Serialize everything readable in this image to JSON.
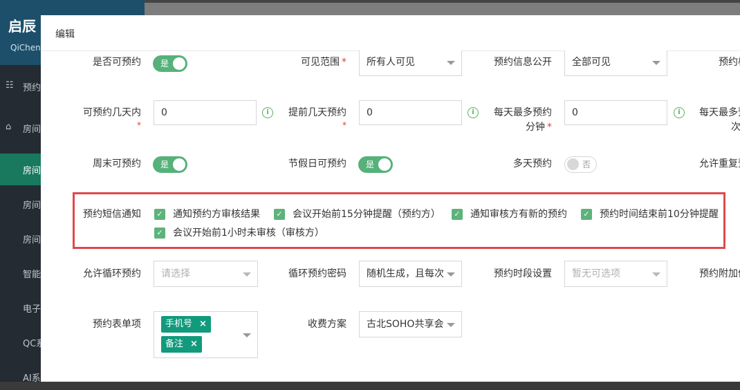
{
  "app": {
    "brand_title": "启辰",
    "brand_sub": "QiChen"
  },
  "sidebar": [
    {
      "icon": "☷",
      "label": "预约"
    },
    {
      "icon": "⌂",
      "label": "房间"
    },
    {
      "icon": "",
      "label": "房间"
    },
    {
      "icon": "",
      "label": "房间"
    },
    {
      "icon": "",
      "label": "房间"
    },
    {
      "icon": "",
      "label": "智能"
    },
    {
      "icon": "",
      "label": "电子"
    },
    {
      "icon": "",
      "label": "QC系"
    },
    {
      "icon": "",
      "label": "AI系"
    }
  ],
  "modal": {
    "title": "编辑"
  },
  "form": {
    "row1": {
      "bookable_label": "是否可预约",
      "bookable_toggle": "是",
      "visible_label": "可见范围",
      "visible_value": "所有人可见",
      "info_public_label": "预约信息公开",
      "info_public_value": "全部可见",
      "cut_label": "预约栏"
    },
    "row2": {
      "days_label_a": "可预约几天内",
      "days_value": "0",
      "advance_label": "提前几天预约",
      "advance_value": "0",
      "max_minutes_label_a": "每天最多预约",
      "max_minutes_label_b": "分钟",
      "max_minutes_value": "0",
      "max_times_label_a": "每天最多预",
      "max_times_label_b": "次"
    },
    "row3": {
      "weekend_label": "周末可预约",
      "weekend_toggle": "是",
      "holiday_label": "节假日可预约",
      "holiday_toggle": "是",
      "multiday_label": "多天预约",
      "multiday_toggle": "否",
      "repeat_label": "允许重复预"
    },
    "sms": {
      "label": "预约短信通知",
      "options": [
        "通知预约方审核结果",
        "会议开始前15分钟提醒（预约方）",
        "通知审核方有新的预约",
        "预约时间结束前10分钟提醒",
        "会议开始前1小时未审核（审核方）"
      ]
    },
    "row5": {
      "loop_label": "允许循环预约",
      "loop_placeholder": "请选择",
      "loop_pwd_label": "循环预约密码",
      "loop_pwd_value": "随机生成，且每次",
      "slot_label": "预约时段设置",
      "slot_placeholder": "暂无可选项",
      "extra_label": "预约附加信"
    },
    "row6": {
      "form_items_label": "预约表单项",
      "tags": [
        "手机号",
        "备注"
      ],
      "fee_label": "收费方案",
      "fee_value": "古北SOHO共享会"
    }
  },
  "colors": {
    "accent": "#56b17a",
    "highlight_border": "#e0484c",
    "tag": "#129a7d",
    "sidebar_active": "#18795e"
  }
}
